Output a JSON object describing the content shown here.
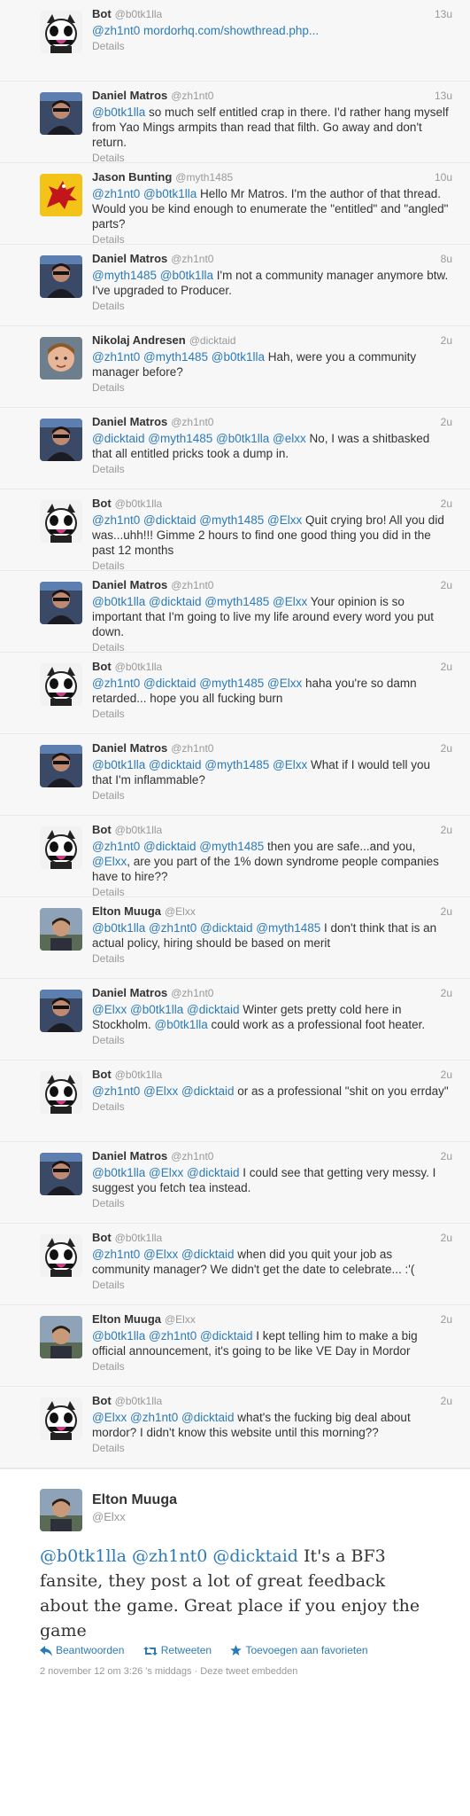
{
  "details_label": "Details",
  "tweets": [
    {
      "name": "Bot",
      "handle": "@b0tk1lla",
      "time": "13u",
      "avatar": "bot",
      "segments": [
        {
          "t": "@zh1nt0",
          "m": true
        },
        {
          "t": " "
        },
        {
          "t": "mordorhq.com/showthread.php...",
          "m": true
        }
      ]
    },
    {
      "name": "Daniel Matros",
      "handle": "@zh1nt0",
      "time": "13u",
      "avatar": "daniel",
      "segments": [
        {
          "t": "@b0tk1lla",
          "m": true
        },
        {
          "t": " so much self entitled crap in there. I'd rather hang myself from Yao Mings armpits than read that filth. Go away and don't return."
        }
      ]
    },
    {
      "name": "Jason Bunting",
      "handle": "@myth1485",
      "time": "10u",
      "avatar": "jason",
      "segments": [
        {
          "t": "@zh1nt0",
          "m": true
        },
        {
          "t": " "
        },
        {
          "t": "@b0tk1lla",
          "m": true
        },
        {
          "t": " Hello Mr Matros. I'm the author of that thread. Would you be kind enough to enumerate the \"entitled\" and \"angled\" parts?"
        }
      ]
    },
    {
      "name": "Daniel Matros",
      "handle": "@zh1nt0",
      "time": "8u",
      "avatar": "daniel",
      "segments": [
        {
          "t": "@myth1485",
          "m": true
        },
        {
          "t": " "
        },
        {
          "t": "@b0tk1lla",
          "m": true
        },
        {
          "t": " I'm not a community manager anymore btw. I've upgraded to Producer."
        }
      ]
    },
    {
      "name": "Nikolaj Andresen",
      "handle": "@dicktaid",
      "time": "2u",
      "avatar": "nikolaj",
      "segments": [
        {
          "t": "@zh1nt0",
          "m": true
        },
        {
          "t": " "
        },
        {
          "t": "@myth1485",
          "m": true
        },
        {
          "t": " "
        },
        {
          "t": "@b0tk1lla",
          "m": true
        },
        {
          "t": " Hah, were you a community manager before?"
        }
      ]
    },
    {
      "name": "Daniel Matros",
      "handle": "@zh1nt0",
      "time": "2u",
      "avatar": "daniel",
      "segments": [
        {
          "t": "@dicktaid",
          "m": true
        },
        {
          "t": " "
        },
        {
          "t": "@myth1485",
          "m": true
        },
        {
          "t": " "
        },
        {
          "t": "@b0tk1lla",
          "m": true
        },
        {
          "t": " "
        },
        {
          "t": "@elxx",
          "m": true
        },
        {
          "t": " No, I was a shitbasked that all entitled pricks took a dump in."
        }
      ]
    },
    {
      "name": "Bot",
      "handle": "@b0tk1lla",
      "time": "2u",
      "avatar": "bot",
      "segments": [
        {
          "t": "@zh1nt0",
          "m": true
        },
        {
          "t": " "
        },
        {
          "t": "@dicktaid",
          "m": true
        },
        {
          "t": " "
        },
        {
          "t": "@myth1485",
          "m": true
        },
        {
          "t": " "
        },
        {
          "t": "@Elxx",
          "m": true
        },
        {
          "t": " Quit crying bro! All you did was...uhh!!! Gimme 2 hours to find one good thing you did in the past 12 months"
        }
      ]
    },
    {
      "name": "Daniel Matros",
      "handle": "@zh1nt0",
      "time": "2u",
      "avatar": "daniel",
      "segments": [
        {
          "t": "@b0tk1lla",
          "m": true
        },
        {
          "t": " "
        },
        {
          "t": "@dicktaid",
          "m": true
        },
        {
          "t": " "
        },
        {
          "t": "@myth1485",
          "m": true
        },
        {
          "t": " "
        },
        {
          "t": "@Elxx",
          "m": true
        },
        {
          "t": " Your opinion is so important that I'm going to live my life around every word you put down."
        }
      ]
    },
    {
      "name": "Bot",
      "handle": "@b0tk1lla",
      "time": "2u",
      "avatar": "bot",
      "segments": [
        {
          "t": "@zh1nt0",
          "m": true
        },
        {
          "t": " "
        },
        {
          "t": "@dicktaid",
          "m": true
        },
        {
          "t": " "
        },
        {
          "t": "@myth1485",
          "m": true
        },
        {
          "t": " "
        },
        {
          "t": "@Elxx",
          "m": true
        },
        {
          "t": " haha you're so damn retarded... hope you all fucking burn"
        }
      ]
    },
    {
      "name": "Daniel Matros",
      "handle": "@zh1nt0",
      "time": "2u",
      "avatar": "daniel",
      "segments": [
        {
          "t": "@b0tk1lla",
          "m": true
        },
        {
          "t": " "
        },
        {
          "t": "@dicktaid",
          "m": true
        },
        {
          "t": " "
        },
        {
          "t": "@myth1485",
          "m": true
        },
        {
          "t": " "
        },
        {
          "t": "@Elxx",
          "m": true
        },
        {
          "t": " What if I would tell you that I'm inflammable?"
        }
      ]
    },
    {
      "name": "Bot",
      "handle": "@b0tk1lla",
      "time": "2u",
      "avatar": "bot",
      "segments": [
        {
          "t": "@zh1nt0",
          "m": true
        },
        {
          "t": " "
        },
        {
          "t": "@dicktaid",
          "m": true
        },
        {
          "t": " "
        },
        {
          "t": "@myth1485",
          "m": true
        },
        {
          "t": " then you are safe...and you, "
        },
        {
          "t": "@Elxx",
          "m": true
        },
        {
          "t": ", are you part of the 1% down syndrome people companies have to hire??"
        }
      ]
    },
    {
      "name": "Elton Muuga",
      "handle": "@Elxx",
      "time": "2u",
      "avatar": "elton",
      "segments": [
        {
          "t": "@b0tk1lla",
          "m": true
        },
        {
          "t": " "
        },
        {
          "t": "@zh1nt0",
          "m": true
        },
        {
          "t": " "
        },
        {
          "t": "@dicktaid",
          "m": true
        },
        {
          "t": " "
        },
        {
          "t": "@myth1485",
          "m": true
        },
        {
          "t": " I don't think that is an actual policy, hiring should be based on merit"
        }
      ]
    },
    {
      "name": "Daniel Matros",
      "handle": "@zh1nt0",
      "time": "2u",
      "avatar": "daniel",
      "segments": [
        {
          "t": "@Elxx",
          "m": true
        },
        {
          "t": " "
        },
        {
          "t": "@b0tk1lla",
          "m": true
        },
        {
          "t": " "
        },
        {
          "t": "@dicktaid",
          "m": true
        },
        {
          "t": " Winter gets pretty cold here in Stockholm. "
        },
        {
          "t": "@b0tk1lla",
          "m": true
        },
        {
          "t": " could work as a professional foot heater."
        }
      ]
    },
    {
      "name": "Bot",
      "handle": "@b0tk1lla",
      "time": "2u",
      "avatar": "bot",
      "segments": [
        {
          "t": "@zh1nt0",
          "m": true
        },
        {
          "t": " "
        },
        {
          "t": "@Elxx",
          "m": true
        },
        {
          "t": " "
        },
        {
          "t": "@dicktaid",
          "m": true
        },
        {
          "t": " or as a professional \"shit on you errday\""
        }
      ]
    },
    {
      "name": "Daniel Matros",
      "handle": "@zh1nt0",
      "time": "2u",
      "avatar": "daniel",
      "segments": [
        {
          "t": "@b0tk1lla",
          "m": true
        },
        {
          "t": " "
        },
        {
          "t": "@Elxx",
          "m": true
        },
        {
          "t": " "
        },
        {
          "t": "@dicktaid",
          "m": true
        },
        {
          "t": " I could see that getting very messy. I suggest you fetch tea instead."
        }
      ]
    },
    {
      "name": "Bot",
      "handle": "@b0tk1lla",
      "time": "2u",
      "avatar": "bot",
      "segments": [
        {
          "t": "@zh1nt0",
          "m": true
        },
        {
          "t": " "
        },
        {
          "t": "@Elxx",
          "m": true
        },
        {
          "t": " "
        },
        {
          "t": "@dicktaid",
          "m": true
        },
        {
          "t": " when did you quit your job as community manager? We didn't get the date to celebrate... :'("
        }
      ]
    },
    {
      "name": "Elton Muuga",
      "handle": "@Elxx",
      "time": "2u",
      "avatar": "elton",
      "segments": [
        {
          "t": "@b0tk1lla",
          "m": true
        },
        {
          "t": " "
        },
        {
          "t": "@zh1nt0",
          "m": true
        },
        {
          "t": " "
        },
        {
          "t": "@dicktaid",
          "m": true
        },
        {
          "t": " I kept telling him to make a big official announcement, it's going to be like VE Day in Mordor"
        }
      ]
    },
    {
      "name": "Bot",
      "handle": "@b0tk1lla",
      "time": "2u",
      "avatar": "bot",
      "segments": [
        {
          "t": "@Elxx",
          "m": true
        },
        {
          "t": " "
        },
        {
          "t": "@zh1nt0",
          "m": true
        },
        {
          "t": " "
        },
        {
          "t": "@dicktaid",
          "m": true
        },
        {
          "t": " what's the fucking big deal about mordor? I didn't know this website until this morning??"
        }
      ]
    }
  ],
  "main": {
    "name": "Elton Muuga",
    "handle": "@Elxx",
    "mention1": "@b0tk1lla",
    "mention2": "@zh1nt0",
    "mention3": "@dicktaid",
    "text": " It's a BF3 fansite, they post a lot of great feedback about the game. Great place if you enjoy the game",
    "reply_label": "Beantwoorden",
    "retweet_label": "Retweeten",
    "favorite_label": "Toevoegen aan favorieten",
    "timestamp": "2 november 12 om 3:26 's middags",
    "separator": " · ",
    "embed_label": "Deze tweet embedden"
  }
}
